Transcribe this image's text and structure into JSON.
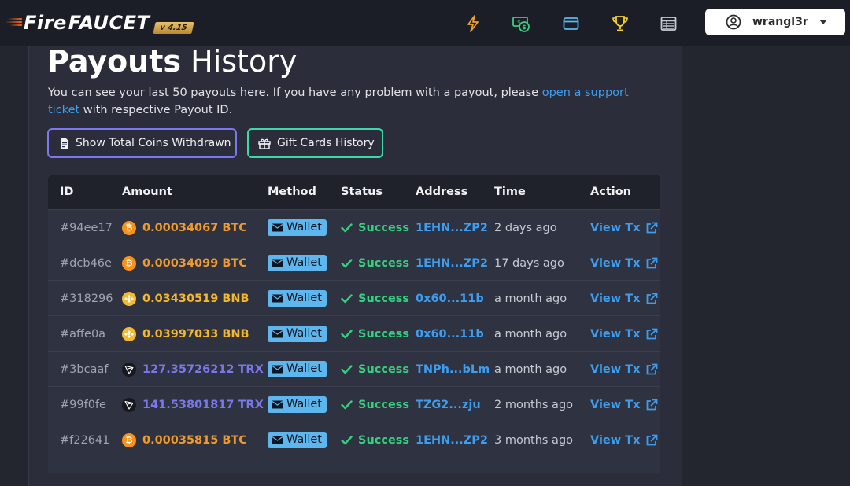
{
  "brand": {
    "fire": "Fire",
    "faucet": "FAUCET",
    "version": "v 4.15"
  },
  "nav": {
    "icons": [
      "lightning-icon",
      "money-icon",
      "wallet-icon",
      "trophy-icon",
      "table-icon"
    ],
    "colors": {
      "lightning": "#f0a028",
      "money": "#35d07f",
      "wallet": "#5db7ee",
      "trophy": "#f5d228",
      "table": "#c7c9d3"
    },
    "username": "wrangl3r"
  },
  "page": {
    "title_bold": "Payouts",
    "title_light": "History",
    "desc_before": "You can see your last 50 payouts here. If you have any problem with a payout, please ",
    "desc_link": "open a support ticket",
    "desc_after": " with respective Payout ID.",
    "btn_coins": "Show Total Coins Withdrawn",
    "btn_gift": "Gift Cards History"
  },
  "table": {
    "headers": [
      "ID",
      "Amount",
      "Method",
      "Status",
      "Address",
      "Time",
      "Action"
    ],
    "rows": [
      {
        "id": "#94ee17",
        "coin": "btc",
        "amount": "0.00034067 BTC",
        "amount_color": "#f09a2e",
        "method": "Wallet",
        "status": "Success",
        "address": "1EHN...ZP2",
        "time": "2 days ago",
        "action": "View Tx"
      },
      {
        "id": "#dcb46e",
        "coin": "btc",
        "amount": "0.00034099 BTC",
        "amount_color": "#f09a2e",
        "method": "Wallet",
        "status": "Success",
        "address": "1EHN...ZP2",
        "time": "17 days ago",
        "action": "View Tx"
      },
      {
        "id": "#318296",
        "coin": "bnb",
        "amount": "0.03430519 BNB",
        "amount_color": "#f3b82f",
        "method": "Wallet",
        "status": "Success",
        "address": "0x60...11b",
        "time": "a month ago",
        "action": "View Tx"
      },
      {
        "id": "#affe0a",
        "coin": "bnb",
        "amount": "0.03997033 BNB",
        "amount_color": "#f3b82f",
        "method": "Wallet",
        "status": "Success",
        "address": "0x60...11b",
        "time": "a month ago",
        "action": "View Tx"
      },
      {
        "id": "#3bcaaf",
        "coin": "trx",
        "amount": "127.35726212 TRX",
        "amount_color": "#7b77ee",
        "method": "Wallet",
        "status": "Success",
        "address": "TNPh...bLm",
        "time": "a month ago",
        "action": "View Tx"
      },
      {
        "id": "#99f0fe",
        "coin": "trx",
        "amount": "141.53801817 TRX",
        "amount_color": "#7b77ee",
        "method": "Wallet",
        "status": "Success",
        "address": "TZG2...zju",
        "time": "2 months ago",
        "action": "View Tx"
      },
      {
        "id": "#f22641",
        "coin": "btc",
        "amount": "0.00035815 BTC",
        "amount_color": "#f09a2e",
        "method": "Wallet",
        "status": "Success",
        "address": "1EHN...ZP2",
        "time": "3 months ago",
        "action": "View Tx"
      }
    ]
  }
}
